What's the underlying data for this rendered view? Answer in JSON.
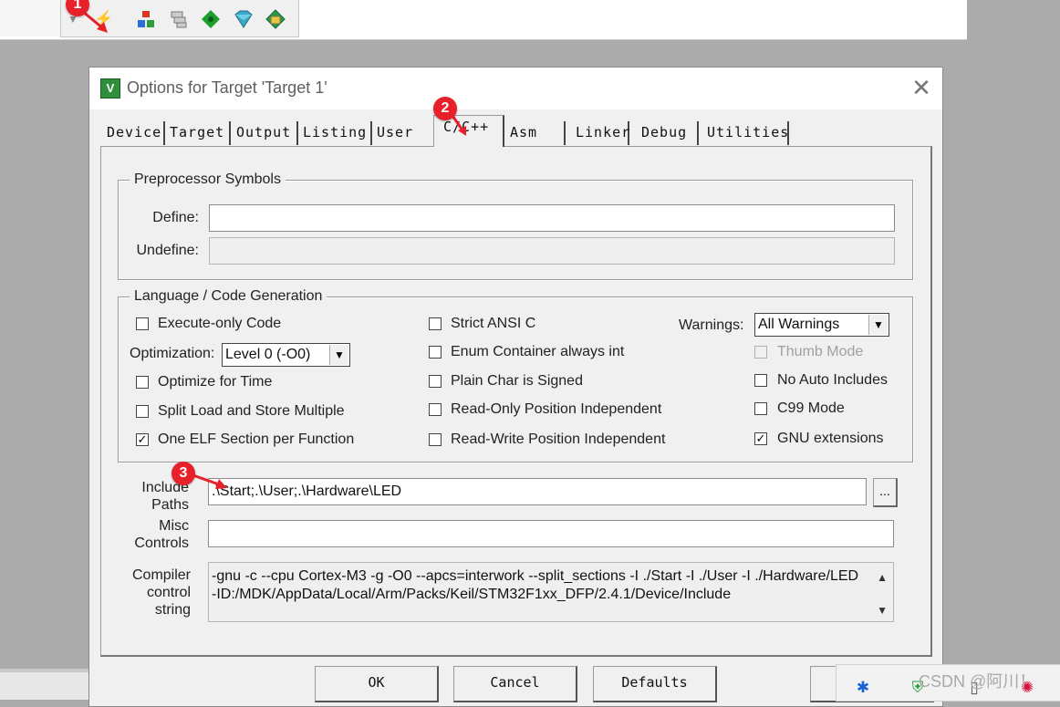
{
  "markers": [
    "1",
    "2",
    "3"
  ],
  "toolbar": {
    "icons": [
      "dropdown-icon",
      "magic-wand-icon",
      "manage-project-items-icon",
      "layers-icon",
      "pack-installer-icon",
      "select-packs-icon",
      "manage-runtime-environment-icon"
    ]
  },
  "dialog": {
    "title": "Options for Target 'Target 1'",
    "close_glyph": "✕",
    "app_icon_glyph": "V",
    "tabs": [
      "Device",
      "Target",
      "Output",
      "Listing",
      "User",
      "C/C++",
      "Asm",
      "Linker",
      "Debug",
      "Utilities"
    ],
    "active_tab": "C/C++",
    "preprocessor": {
      "title": "Preprocessor Symbols",
      "define_label": "Define:",
      "define_value": "",
      "undefine_label": "Undefine:",
      "undefine_value": ""
    },
    "language": {
      "title": "Language / Code Generation",
      "execute_only": {
        "label": "Execute-only Code",
        "checked": false
      },
      "optimization_label": "Optimization:",
      "optimization_value": "Level 0 (-O0)",
      "optimize_time": {
        "label": "Optimize for Time",
        "checked": false
      },
      "split_load": {
        "label": "Split Load and Store Multiple",
        "checked": false
      },
      "one_elf": {
        "label": "One ELF Section per Function",
        "checked": true
      },
      "strict_ansi": {
        "label": "Strict ANSI C",
        "checked": false
      },
      "enum_container": {
        "label": "Enum Container always int",
        "checked": false
      },
      "plain_char": {
        "label": "Plain Char is Signed",
        "checked": false
      },
      "ro_pos": {
        "label": "Read-Only Position Independent",
        "checked": false
      },
      "rw_pos": {
        "label": "Read-Write Position Independent",
        "checked": false
      },
      "warnings_label": "Warnings:",
      "warnings_value": "All Warnings",
      "thumb_mode": {
        "label": "Thumb Mode",
        "checked": false,
        "disabled": true
      },
      "no_auto_includes": {
        "label": "No Auto Includes",
        "checked": false
      },
      "c99_mode": {
        "label": "C99 Mode",
        "checked": false
      },
      "gnu_ext": {
        "label": "GNU extensions",
        "checked": true
      }
    },
    "include": {
      "label_line1": "Include",
      "label_line2": "Paths",
      "value": ".\\Start;.\\User;.\\Hardware\\LED",
      "browse_label": "..."
    },
    "misc": {
      "label_line1": "Misc",
      "label_line2": "Controls",
      "value": ""
    },
    "compiler": {
      "label_line1": "Compiler",
      "label_line2": "control",
      "label_line3": "string",
      "line1": "-gnu -c --cpu Cortex-M3 -g -O0 --apcs=interwork --split_sections -I ./Start -I ./User -I ./Hardware/LED",
      "line2": "-ID:/MDK/AppData/Local/Arm/Packs/Keil/STM32F1xx_DFP/2.4.1/Device/Include"
    },
    "buttons": {
      "ok": "OK",
      "cancel": "Cancel",
      "defaults": "Defaults"
    }
  },
  "check_glyph": "✓",
  "combo_arrow": "▼",
  "tray": {
    "icons": [
      "bluetooth-icon",
      "security-shield-icon",
      "usb-drive-icon",
      "app-tray-icon"
    ],
    "watermark": "CSDN @阿川！"
  }
}
